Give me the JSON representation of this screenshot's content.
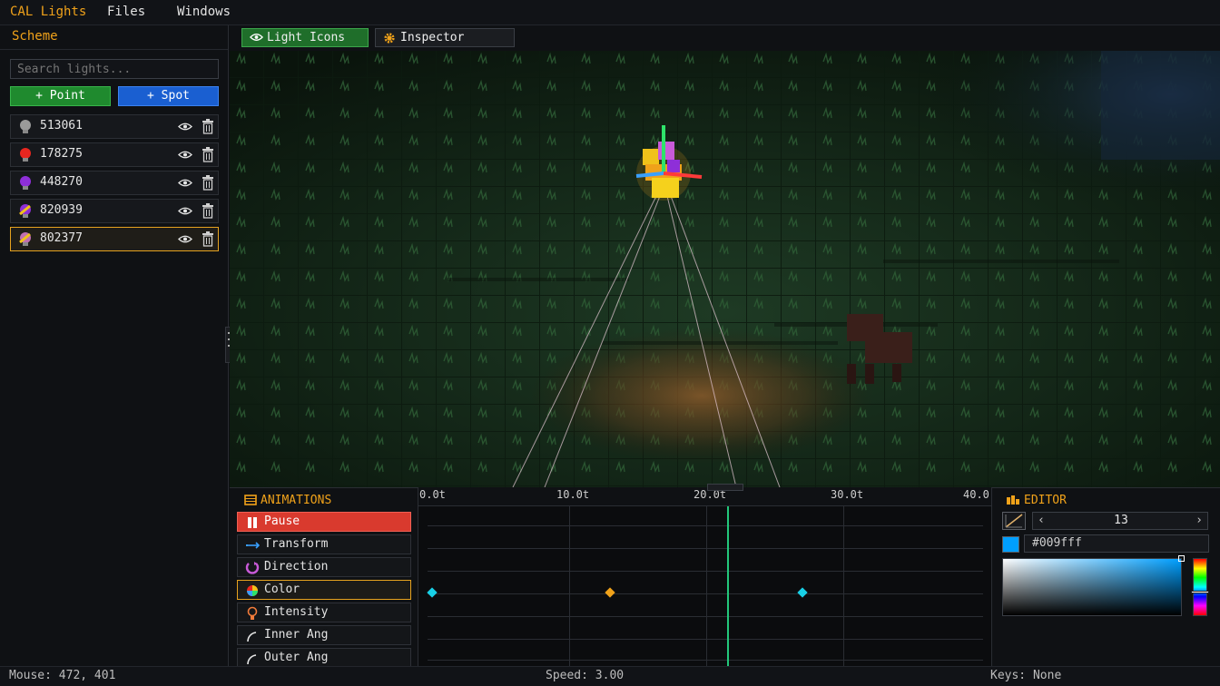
{
  "menubar": {
    "app_title": "CAL Lights",
    "files": "Files",
    "windows": "Windows"
  },
  "scheme": {
    "title": "Scheme",
    "search_placeholder": "Search lights...",
    "add_point": "+ Point",
    "add_spot": "+ Spot",
    "lights": [
      {
        "name": "513061",
        "icon": "gray-bulb-icon",
        "color": "#9a9a9a",
        "selected": false
      },
      {
        "name": "178275",
        "icon": "red-bulb-icon",
        "color": "#e8261f",
        "selected": false
      },
      {
        "name": "448270",
        "icon": "purple-bulb-icon",
        "color": "#8e2fd8",
        "selected": false
      },
      {
        "name": "820939",
        "icon": "purple-yellow-bulb-icon",
        "color": "#8e2fd8",
        "selected": false
      },
      {
        "name": "802377",
        "icon": "pink-yellow-bulb-icon",
        "color": "#c06fb0",
        "selected": true
      }
    ]
  },
  "tabs": {
    "light_icons": "Light Icons",
    "inspector": "Inspector"
  },
  "animations": {
    "title": "ANIMATIONS",
    "buttons": [
      {
        "label": "Pause",
        "icon": "pause-icon"
      },
      {
        "label": "Transform",
        "icon": "transform-arrows-icon"
      },
      {
        "label": "Direction",
        "icon": "direction-rotate-icon"
      },
      {
        "label": "Color",
        "icon": "color-wheel-icon"
      },
      {
        "label": "Intensity",
        "icon": "lightbulb-icon"
      },
      {
        "label": "Inner Ang",
        "icon": "inner-angle-icon"
      },
      {
        "label": "Outer Ang",
        "icon": "outer-angle-icon"
      }
    ],
    "active": "Color"
  },
  "timeline": {
    "ticks": [
      "0.0t",
      "10.0t",
      "20.0t",
      "30.0t",
      "40.0"
    ],
    "playhead_t": 21.5,
    "keyframes": [
      {
        "t": 0.0,
        "color": "#18d0e6"
      },
      {
        "t": 13.0,
        "color": "#f0a21a"
      },
      {
        "t": 27.0,
        "color": "#18d0e6"
      }
    ]
  },
  "editor": {
    "title": "EDITOR",
    "frame_value": "13",
    "hex_value": "#009fff",
    "swatch_color": "#009fff",
    "hue_color": "#009fff",
    "prev": "‹",
    "next": "›"
  },
  "status": {
    "mouse": "Mouse: 472, 401",
    "speed": "Speed: 3.00",
    "keys": "Keys: None"
  },
  "colors": {
    "accent": "#f0a21a",
    "point_button": "#1f8a2e",
    "spot_button": "#1a5fd1",
    "pause_button": "#d93a2e",
    "playhead": "#23c77b"
  }
}
